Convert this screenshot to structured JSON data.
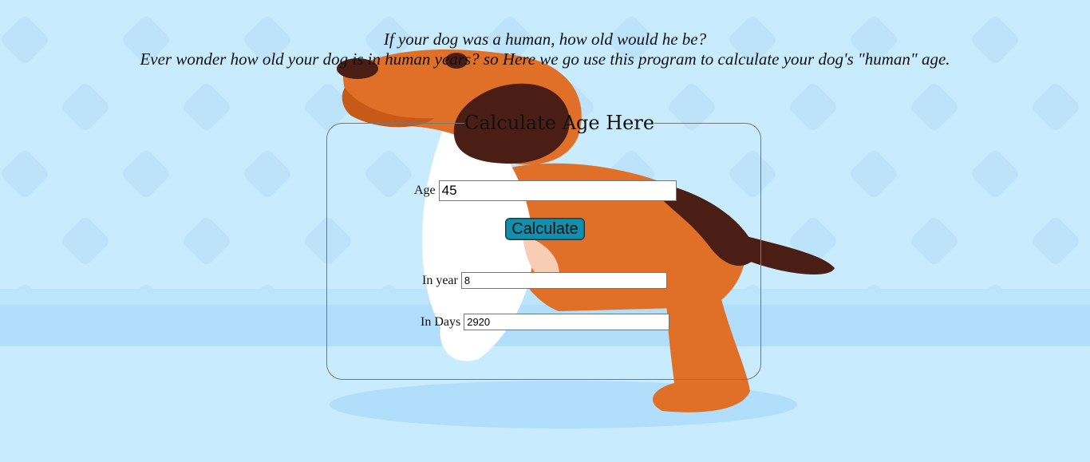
{
  "intro": {
    "question": "If your dog was a human, how old would he be?",
    "description": "Ever wonder how old your dog is in human years? so Here we go use this program to calculate your dog's \"human\" age."
  },
  "form": {
    "legend": "Calculate Age Here",
    "age_label": "Age",
    "age_value": "45",
    "calculate_label": "Calculate",
    "year_label": "In year",
    "year_value": "8",
    "days_label": "In Days",
    "days_value": "2920"
  },
  "colors": {
    "background": "#c8ebfd",
    "button": "#128fad",
    "dog_orange": "#e07028",
    "dog_brown": "#4a1e14"
  },
  "icons": {
    "background_illustration": "cartoon-dog-illustration"
  }
}
